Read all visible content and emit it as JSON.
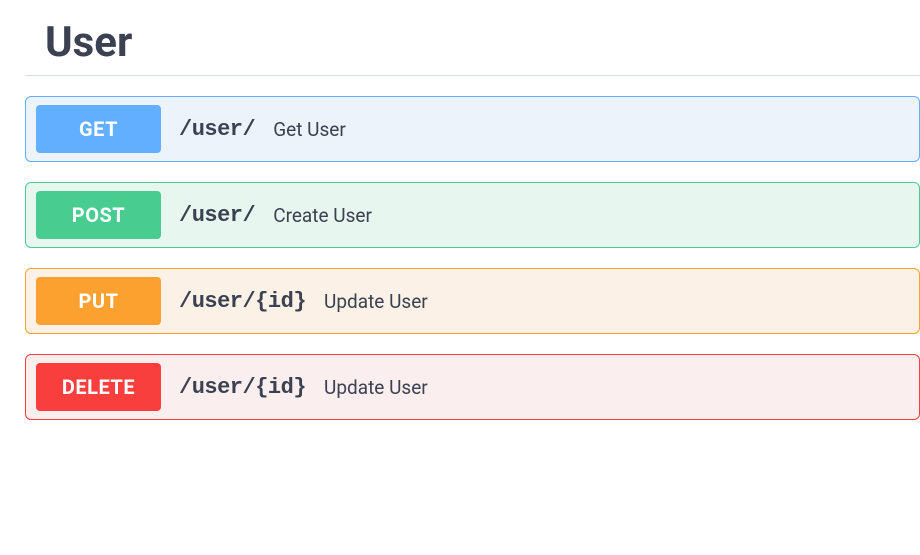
{
  "section": {
    "title": "User"
  },
  "operations": [
    {
      "method": "GET",
      "path": "/user/",
      "summary": "Get User",
      "colors": {
        "bg": "#ecf3fb",
        "border": "#61affe",
        "badge": "#61affe"
      }
    },
    {
      "method": "POST",
      "path": "/user/",
      "summary": "Create User",
      "colors": {
        "bg": "#e8f6f0",
        "border": "#49cc90",
        "badge": "#49cc90"
      }
    },
    {
      "method": "PUT",
      "path": "/user/{id}",
      "summary": "Update User",
      "colors": {
        "bg": "#fbf1e6",
        "border": "#fca130",
        "badge": "#fca130"
      }
    },
    {
      "method": "DELETE",
      "path": "/user/{id}",
      "summary": "Update User",
      "colors": {
        "bg": "#fbeeee",
        "border": "#f93e3e",
        "badge": "#f93e3e"
      }
    }
  ]
}
